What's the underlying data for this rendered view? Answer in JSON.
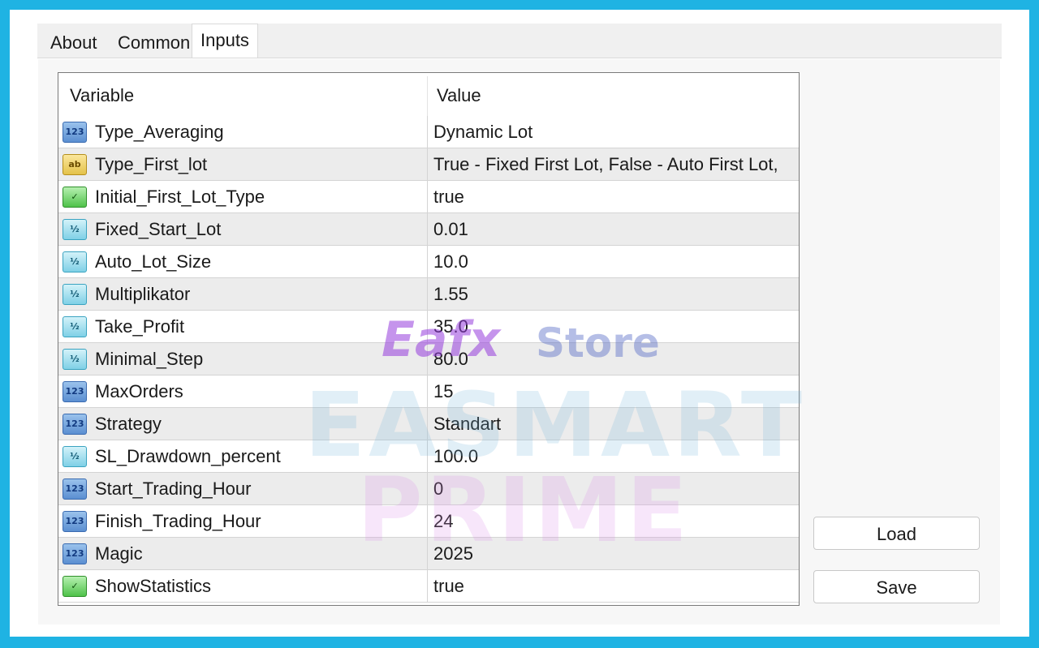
{
  "tabs": [
    {
      "label": "About"
    },
    {
      "label": "Common"
    },
    {
      "label": "Inputs"
    }
  ],
  "grid": {
    "header": {
      "variable": "Variable",
      "value": "Value"
    },
    "rows": [
      {
        "icon": "int-icon",
        "icon_text": "123",
        "variable": "Type_Averaging",
        "value": "Dynamic Lot"
      },
      {
        "icon": "string-icon",
        "icon_text": "ab",
        "variable": "Type_First_lot",
        "value": "True - Fixed First Lot, False - Auto First Lot,"
      },
      {
        "icon": "bool-icon",
        "icon_text": "✓",
        "variable": "Initial_First_Lot_Type",
        "value": "true"
      },
      {
        "icon": "double-icon",
        "icon_text": "½",
        "variable": "Fixed_Start_Lot",
        "value": "0.01"
      },
      {
        "icon": "double-icon",
        "icon_text": "½",
        "variable": "Auto_Lot_Size",
        "value": "10.0"
      },
      {
        "icon": "double-icon",
        "icon_text": "½",
        "variable": "Multiplikator",
        "value": "1.55"
      },
      {
        "icon": "double-icon",
        "icon_text": "½",
        "variable": "Take_Profit",
        "value": "35.0"
      },
      {
        "icon": "double-icon",
        "icon_text": "½",
        "variable": "Minimal_Step",
        "value": "80.0"
      },
      {
        "icon": "int-icon",
        "icon_text": "123",
        "variable": "MaxOrders",
        "value": "15"
      },
      {
        "icon": "int-icon",
        "icon_text": "123",
        "variable": "Strategy",
        "value": "Standart"
      },
      {
        "icon": "double-icon",
        "icon_text": "½",
        "variable": "SL_Drawdown_percent",
        "value": "100.0"
      },
      {
        "icon": "int-icon",
        "icon_text": "123",
        "variable": "Start_Trading_Hour",
        "value": "0"
      },
      {
        "icon": "int-icon",
        "icon_text": "123",
        "variable": "Finish_Trading_Hour",
        "value": "24"
      },
      {
        "icon": "int-icon",
        "icon_text": "123",
        "variable": "Magic",
        "value": "2025"
      },
      {
        "icon": "bool-icon",
        "icon_text": "✓",
        "variable": "ShowStatistics",
        "value": "true"
      }
    ]
  },
  "buttons": {
    "load": "Load",
    "save": "Save"
  },
  "watermark": {
    "brand1": "Eafx",
    "brand2": "Store",
    "line1": "EASMART",
    "line2": "PRIME"
  },
  "colors": {
    "frame": "#1fb3e3"
  }
}
